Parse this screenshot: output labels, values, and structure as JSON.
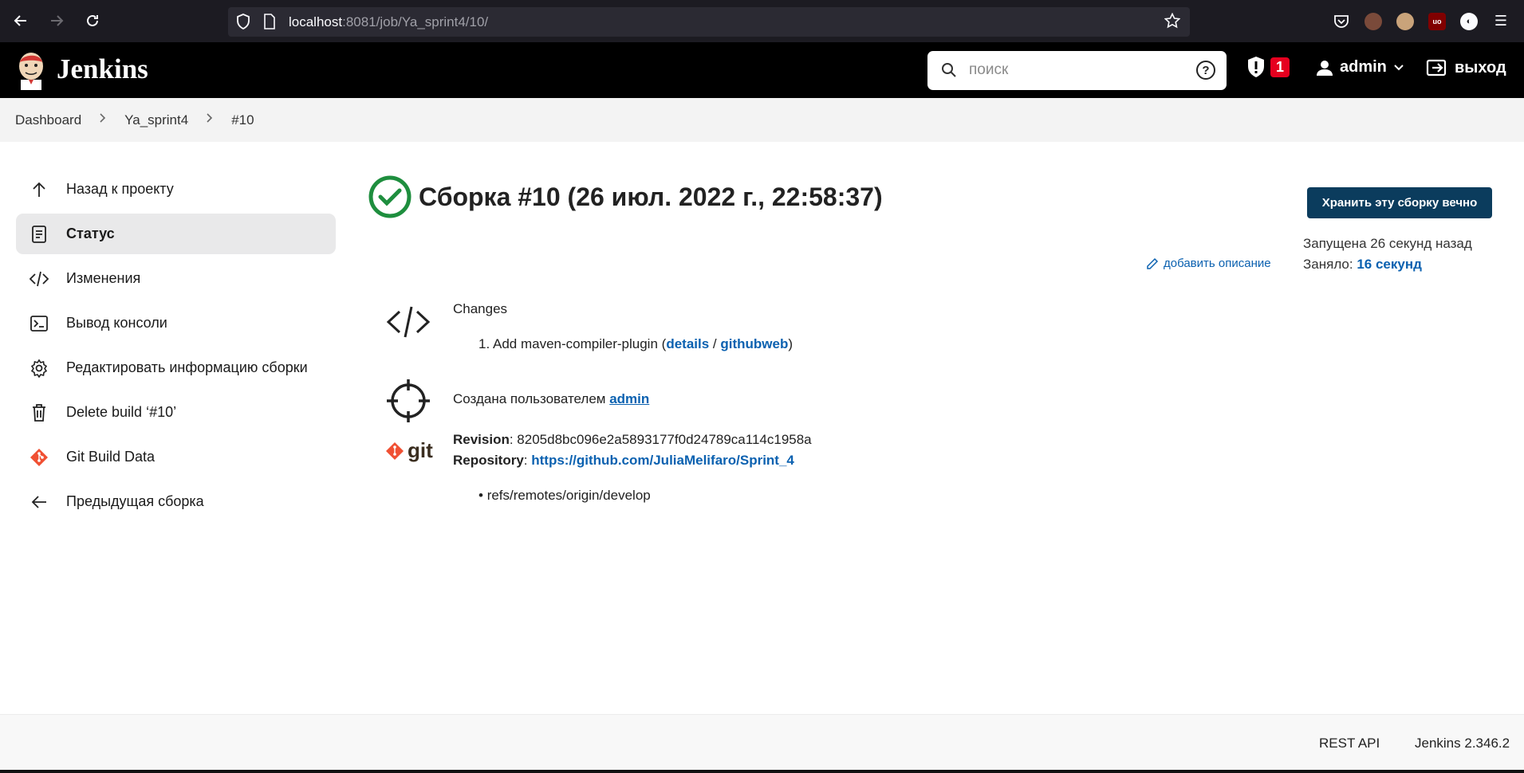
{
  "browser": {
    "url_host": "localhost",
    "url_rest": ":8081/job/Ya_sprint4/10/"
  },
  "header": {
    "title": "Jenkins",
    "search_placeholder": "поиск",
    "help": "?",
    "alert_count": "1",
    "user": "admin",
    "logout": "выход"
  },
  "breadcrumb": {
    "items": [
      "Dashboard",
      "Ya_sprint4",
      "#10"
    ]
  },
  "sidebar": {
    "items": [
      {
        "label": "Назад к проекту",
        "icon": "arrow-up-icon"
      },
      {
        "label": "Статус",
        "icon": "document-icon"
      },
      {
        "label": "Изменения",
        "icon": "code-icon"
      },
      {
        "label": "Вывод консоли",
        "icon": "terminal-icon"
      },
      {
        "label": "Редактировать информацию сборки",
        "icon": "gear-icon"
      },
      {
        "label": "Delete build ‘#10’",
        "icon": "trash-icon"
      },
      {
        "label": "Git Build Data",
        "icon": "git-icon"
      },
      {
        "label": "Предыдущая сборка",
        "icon": "arrow-left-icon"
      }
    ]
  },
  "build": {
    "title": "Сборка #10 (26 июл. 2022 г., 22:58:37)",
    "keep_button": "Хранить эту сборку вечно",
    "started": "Запущена 26 секунд назад",
    "took_label": "Заняло: ",
    "took_value": "16 секунд",
    "add_description": "добавить описание",
    "changes_label": "Changes",
    "change_number": "1.",
    "change_text": "Add maven-compiler-plugin (",
    "change_details": "details",
    "change_sep": " / ",
    "change_githubweb": "githubweb",
    "change_close": ")",
    "created_by": "Создана пользователем ",
    "created_user": "admin",
    "git_logo_text": "git",
    "revision_label": "Revision",
    "revision_value": ": 8205d8bc096e2a5893177f0d24789ca114c1958a",
    "repository_label": "Repository",
    "repository_colon": ": ",
    "repository_url": "https://github.com/JuliaMelifaro/Sprint_4",
    "branch": "refs/remotes/origin/develop"
  },
  "footer": {
    "rest_api": "REST API",
    "version": "Jenkins 2.346.2"
  },
  "colors": {
    "header_bg": "#000000",
    "link": "#0b61b0",
    "keep_button_bg": "#0b3c5d",
    "success": "#1e8e3e",
    "alert_badge": "#e6001f"
  }
}
